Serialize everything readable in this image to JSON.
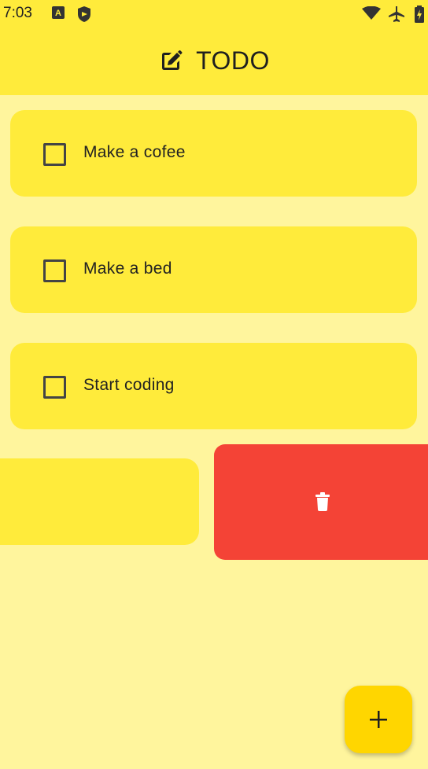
{
  "status_bar": {
    "time": "7:03",
    "icons": [
      "a-notification-icon",
      "shield-icon",
      "wifi-icon",
      "airplane-icon",
      "battery-icon"
    ]
  },
  "app_bar": {
    "title": "TODO",
    "icon": "edit-icon"
  },
  "todos": [
    {
      "label": "Make a cofee",
      "checked": false
    },
    {
      "label": "Make a bed",
      "checked": false
    },
    {
      "label": "Start coding",
      "checked": false
    },
    {
      "label": "",
      "checked": false
    }
  ],
  "swipe_delete": {
    "icon": "trash-icon",
    "color": "#F44336"
  },
  "fab": {
    "icon": "plus-icon",
    "color": "#FFD600"
  },
  "colors": {
    "background": "#FFF59D",
    "card": "#FFEB3B",
    "app_bar": "#FFEB3B"
  }
}
